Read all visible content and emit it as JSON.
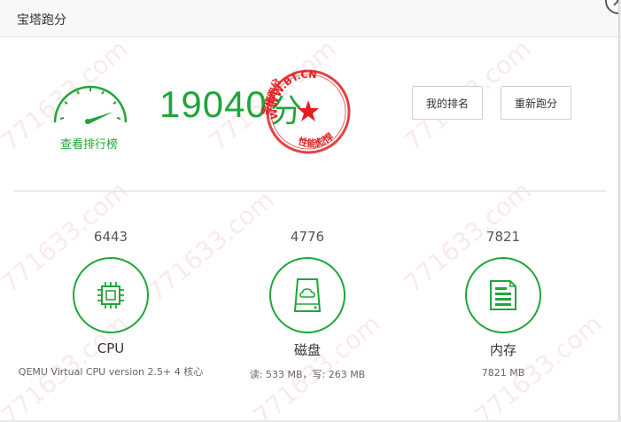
{
  "window": {
    "title": "宝塔跑分"
  },
  "watermark": {
    "text": "771633.com"
  },
  "score": {
    "value": "19040",
    "unit": "分",
    "rank_link": "查看排行榜"
  },
  "stamp": {
    "top_text": "WWW.BT.CN",
    "left_text": "宝塔跑分",
    "bottom_text": "性能彪悍",
    "color": "#e02020"
  },
  "buttons": {
    "my_rank": "我的排名",
    "retest": "重新跑分"
  },
  "colors": {
    "accent": "#20a53a",
    "stamp": "#e02020"
  },
  "metrics": [
    {
      "value": "6443",
      "name": "CPU",
      "detail": "QEMU Virtual CPU version 2.5+ 4 核心",
      "icon": "cpu-chip-icon"
    },
    {
      "value": "4776",
      "name": "磁盘",
      "detail": "读: 533 MB，写: 263 MB",
      "icon": "disk-cloud-icon"
    },
    {
      "value": "7821",
      "name": "内存",
      "detail": "7821 MB",
      "icon": "memory-doc-icon"
    }
  ]
}
